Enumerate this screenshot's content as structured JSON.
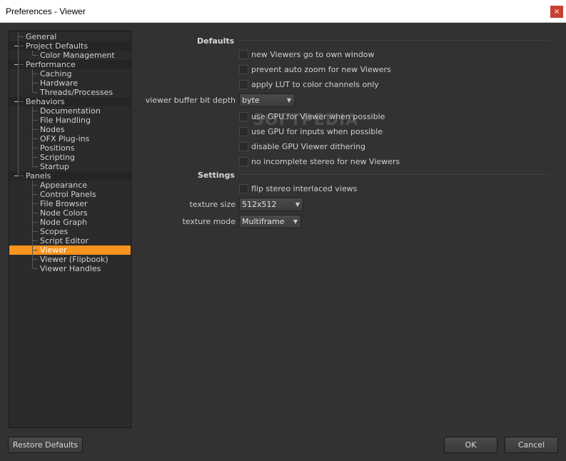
{
  "window": {
    "title": "Preferences - Viewer",
    "close_glyph": "×"
  },
  "tree": {
    "items": [
      {
        "label": "General",
        "level": 0
      },
      {
        "label": "Project Defaults",
        "level": 0,
        "expanded": true
      },
      {
        "label": "Color Management",
        "level": 1
      },
      {
        "label": "Performance",
        "level": 0,
        "expanded": true
      },
      {
        "label": "Caching",
        "level": 1
      },
      {
        "label": "Hardware",
        "level": 1
      },
      {
        "label": "Threads/Processes",
        "level": 1
      },
      {
        "label": "Behaviors",
        "level": 0,
        "expanded": true
      },
      {
        "label": "Documentation",
        "level": 1
      },
      {
        "label": "File Handling",
        "level": 1
      },
      {
        "label": "Nodes",
        "level": 1
      },
      {
        "label": "OFX Plug-ins",
        "level": 1
      },
      {
        "label": "Positions",
        "level": 1
      },
      {
        "label": "Scripting",
        "level": 1
      },
      {
        "label": "Startup",
        "level": 1
      },
      {
        "label": "Panels",
        "level": 0,
        "expanded": true
      },
      {
        "label": "Appearance",
        "level": 1
      },
      {
        "label": "Control Panels",
        "level": 1
      },
      {
        "label": "File Browser",
        "level": 1
      },
      {
        "label": "Node Colors",
        "level": 1
      },
      {
        "label": "Node Graph",
        "level": 1
      },
      {
        "label": "Scopes",
        "level": 1
      },
      {
        "label": "Script Editor",
        "level": 1
      },
      {
        "label": "Viewer",
        "level": 1,
        "selected": true
      },
      {
        "label": "Viewer (Flipbook)",
        "level": 1
      },
      {
        "label": "Viewer Handles",
        "level": 1
      }
    ],
    "collapse_glyph": "−",
    "selection_color": "#f7931e"
  },
  "defaults": {
    "heading": "Defaults",
    "check1": {
      "label": "new Viewers go to own window",
      "checked": false
    },
    "check2": {
      "label": "prevent auto zoom for new Viewers",
      "checked": false
    },
    "check3": {
      "label": "apply LUT to color channels only",
      "checked": false
    },
    "bit_depth": {
      "label": "viewer buffer bit depth",
      "value": "byte"
    },
    "check4": {
      "label": "use GPU for Viewer when possible",
      "checked": false
    },
    "check5": {
      "label": "use GPU for inputs when possible",
      "checked": false
    },
    "check6": {
      "label": "disable GPU Viewer dithering",
      "checked": false
    },
    "check7": {
      "label": "no incomplete stereo for new Viewers",
      "checked": false
    }
  },
  "settings": {
    "heading": "Settings",
    "check1": {
      "label": "flip stereo interlaced views",
      "checked": false
    },
    "texture_size": {
      "label": "texture size",
      "value": "512x512"
    },
    "texture_mode": {
      "label": "texture mode",
      "value": "Multiframe"
    }
  },
  "dropdown_arrow": "▼",
  "watermark": "SOFTPEDIA",
  "buttons": {
    "restore": "Restore Defaults",
    "ok": "OK",
    "cancel": "Cancel"
  }
}
